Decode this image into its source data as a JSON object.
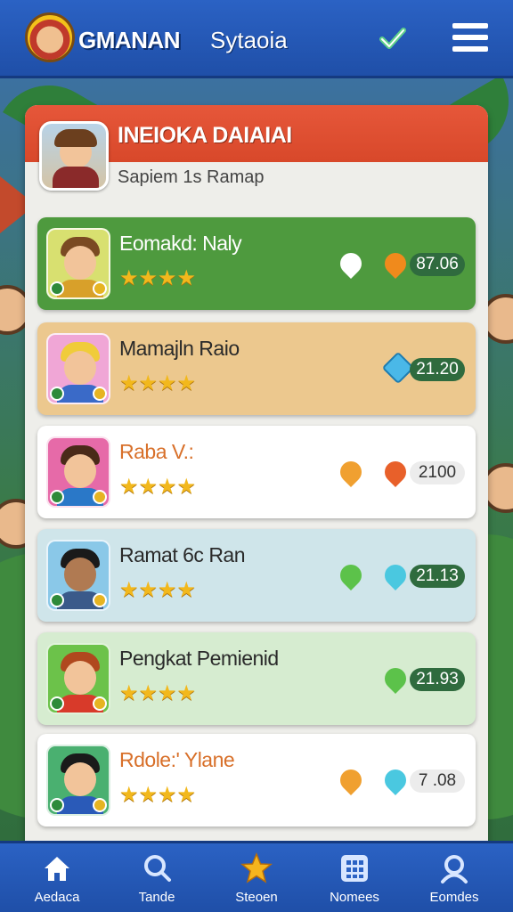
{
  "header": {
    "brand": "GMANAN",
    "title": "Sytaoia"
  },
  "panel": {
    "title": "INEIOKA DAIAIAI",
    "subtitle": "Sapiem 1s Ramap"
  },
  "rows": [
    {
      "name": "Eomakd: Naly",
      "stars": "★★★★",
      "score": "87.06",
      "pin_color": "#ffffff",
      "gem_color": "#f08a1c"
    },
    {
      "name": "Mamajln Raio",
      "stars": "★★★★",
      "score": "21.20",
      "pin_color": "",
      "gem_color": "#4ab8e8"
    },
    {
      "name": "Raba V.:",
      "stars": "★★★★",
      "score": "2100",
      "pin_color": "#f0a030",
      "gem_color": "#e8602a"
    },
    {
      "name": "Ramat 6c Ran",
      "stars": "★★★★",
      "score": "21.13",
      "pin_color": "#5cc24a",
      "gem_color": "#4ac8e0"
    },
    {
      "name": "Pengkat Pemienid",
      "stars": "★★★★",
      "score": "21.93",
      "pin_color": "",
      "gem_color": "#5cc24a"
    },
    {
      "name": "Rdole:' Ylane",
      "stars": "★★★★",
      "score": "7 .08",
      "pin_color": "#f0a030",
      "gem_color": "#4ac8e0"
    }
  ],
  "nav": [
    {
      "label": "Aedaca",
      "icon": "home-icon"
    },
    {
      "label": "Tande",
      "icon": "search-icon"
    },
    {
      "label": "Steoen",
      "icon": "star-icon"
    },
    {
      "label": "Nomees",
      "icon": "grid-icon"
    },
    {
      "label": "Eomdes",
      "icon": "profile-icon"
    }
  ]
}
